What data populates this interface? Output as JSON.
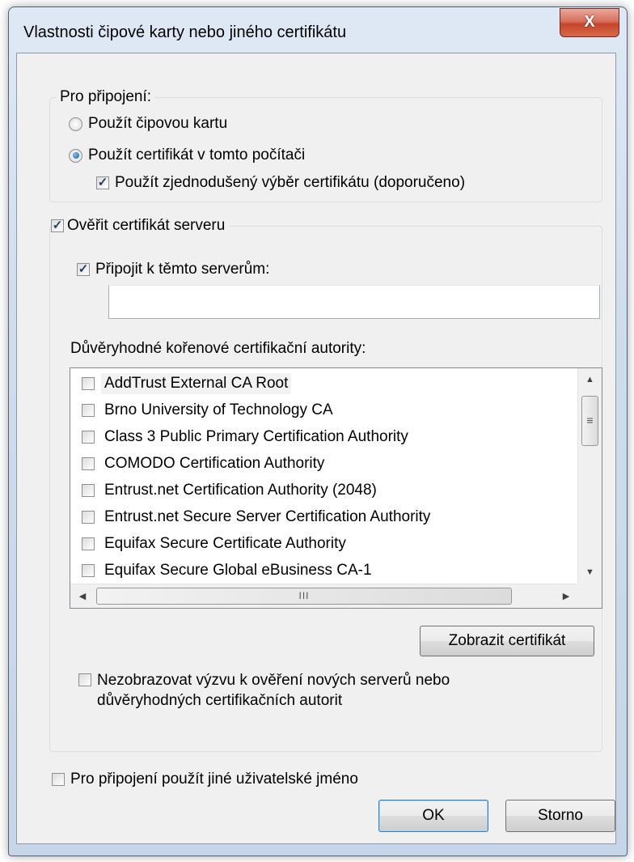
{
  "window": {
    "title": "Vlastnosti čipové karty nebo jiného certifikátu",
    "close_label": "X"
  },
  "connection": {
    "legend": "Pro připojení:",
    "use_smart_card": {
      "label": "Použít čipovou kartu",
      "selected": false
    },
    "use_certificate": {
      "label": "Použít certifikát v tomto počítači",
      "selected": true
    },
    "simple_selection": {
      "label": "Použít zjednodušený výběr certifikátu (doporučeno)",
      "checked": true
    }
  },
  "server_validation": {
    "legend_checkbox": {
      "label": "Ověřit certifikát serveru",
      "checked": true
    },
    "connect_to_servers": {
      "label": "Připojit k těmto serverům:",
      "checked": true
    },
    "servers_value": "",
    "trusted_roots_label": "Důvěryhodné kořenové certifikační autority:",
    "trusted_roots": [
      {
        "label": "AddTrust External CA Root",
        "checked": false
      },
      {
        "label": "Brno University of Technology CA",
        "checked": false
      },
      {
        "label": "Class 3 Public Primary Certification Authority",
        "checked": false
      },
      {
        "label": "COMODO Certification Authority",
        "checked": false
      },
      {
        "label": "Entrust.net Certification Authority (2048)",
        "checked": false
      },
      {
        "label": "Entrust.net Secure Server Certification Authority",
        "checked": false
      },
      {
        "label": "Equifax Secure Certificate Authority",
        "checked": false
      },
      {
        "label": "Equifax Secure Global eBusiness CA-1",
        "checked": false
      }
    ],
    "view_certificate_button": "Zobrazit certifikát",
    "no_prompt": {
      "label": "Nezobrazovat výzvu k ověření nových serverů nebo důvěryhodných certifikačních autorit",
      "checked": false
    }
  },
  "other_user": {
    "label": "Pro připojení použít jiné uživatelské jméno",
    "checked": false
  },
  "buttons": {
    "ok": "OK",
    "cancel": "Storno"
  },
  "icons": {
    "check": "✓",
    "scroll_up": "▲",
    "scroll_down": "▼",
    "scroll_left": "◀",
    "scroll_right": "▶",
    "thumb_grip_v": "≡",
    "thumb_grip_h": "III"
  }
}
